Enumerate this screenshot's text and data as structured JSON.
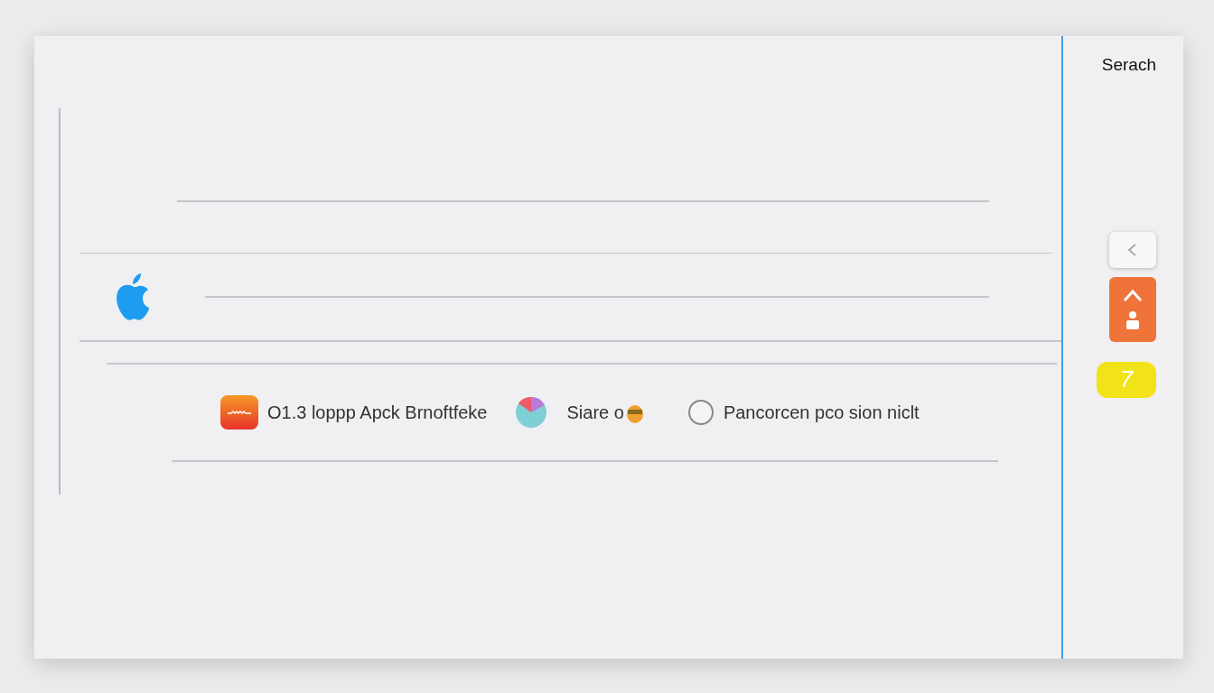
{
  "search": {
    "label": "Serach"
  },
  "items": [
    {
      "kind": "app",
      "label": "O1.3 loppp Apck Brnoftfeke"
    },
    {
      "kind": "app2",
      "label": "Siare o"
    },
    {
      "kind": "radio",
      "label": "Pancorcen pco sion niclt",
      "selected": false
    }
  ],
  "side_buttons": [
    {
      "kind": "blank"
    },
    {
      "kind": "orange"
    },
    {
      "kind": "yellow",
      "label": "7"
    }
  ]
}
